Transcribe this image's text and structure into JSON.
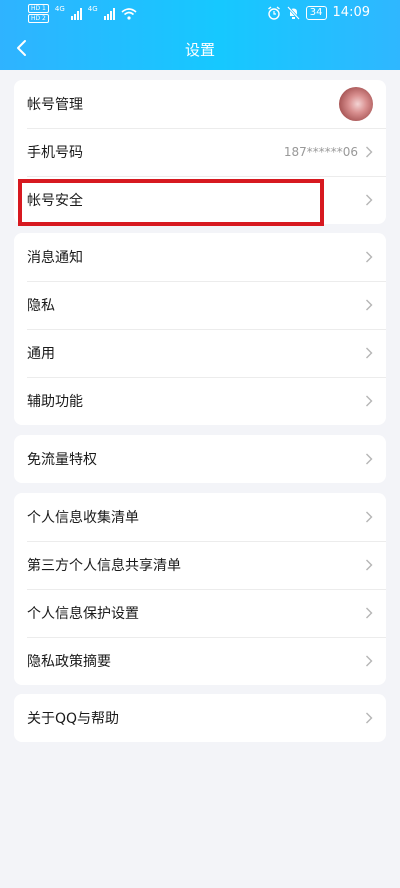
{
  "status_bar": {
    "sim1": "HD 1",
    "sim2": "HD 2",
    "net1": "4G",
    "net2": "4G",
    "battery": "34",
    "time": "14:09"
  },
  "header": {
    "title": "设置"
  },
  "account_group": {
    "account_management": "帐号管理",
    "phone_label": "手机号码",
    "phone_value": "187******06",
    "account_security": "帐号安全"
  },
  "general_group": {
    "items": [
      "消息通知",
      "隐私",
      "通用",
      "辅助功能"
    ]
  },
  "data_group": {
    "items": [
      "免流量特权"
    ]
  },
  "privacy_group": {
    "items": [
      "个人信息收集清单",
      "第三方个人信息共享清单",
      "个人信息保护设置",
      "隐私政策摘要"
    ]
  },
  "about_group": {
    "items": [
      "关于QQ与帮助"
    ]
  },
  "highlight_color": "#d71920",
  "accent_color": "#1fbcff"
}
